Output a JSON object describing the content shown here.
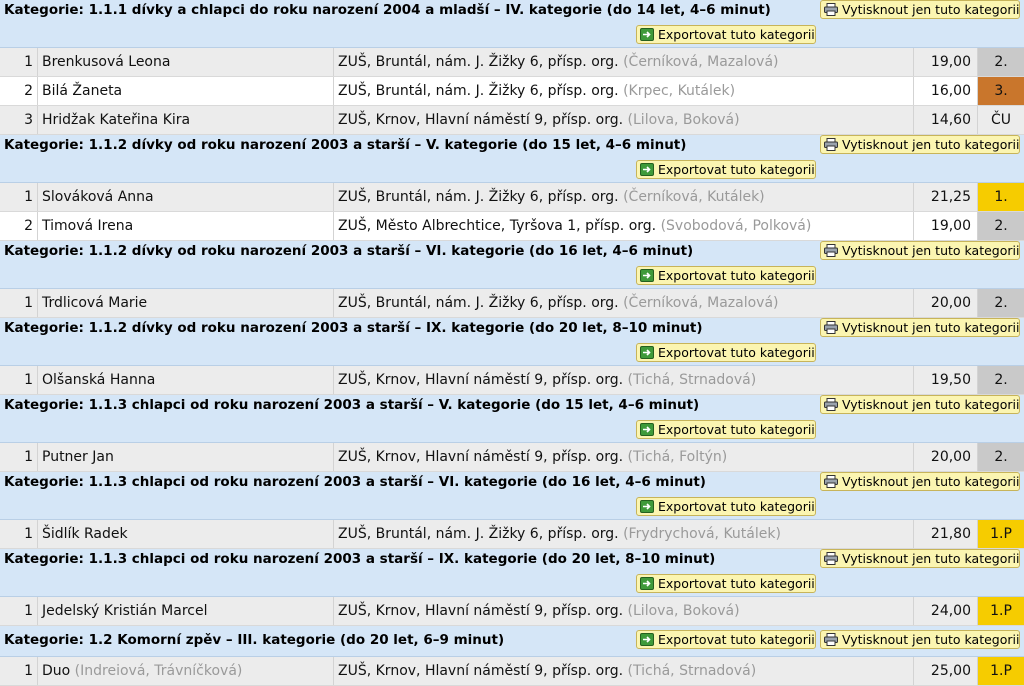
{
  "buttons": {
    "print_label": "Vytisknout jen tuto kategorii",
    "export_label": "Exportovat tuto kategorii"
  },
  "colors": {
    "header_bg": "#d5e6f7",
    "button_bg": "#fbf5b1",
    "place_gold": "#f6cc00",
    "place_silver": "#c9c9c9",
    "place_bronze": "#c9762c"
  },
  "categories": [
    {
      "title": "Kategorie: 1.1.1 dívky a chlapci do roku narození 2004 a mladší – IV. kategorie (do 14 let, 4–6 minut)",
      "rows": [
        {
          "num": "1",
          "name": "Brenkusová Leona",
          "name_extra": "",
          "school": "ZUŠ, Bruntál, nám. J. Žižky 6, přísp. org.",
          "teachers": "(Černíková, Mazalová)",
          "score": "19,00",
          "place": "2.",
          "medal": "silver"
        },
        {
          "num": "2",
          "name": "Bilá Žaneta",
          "name_extra": "",
          "school": "ZUŠ, Bruntál, nám. J. Žižky 6, přísp. org.",
          "teachers": "(Krpec, Kutálek)",
          "score": "16,00",
          "place": "3.",
          "medal": "bronze"
        },
        {
          "num": "3",
          "name": "Hridžak Kateřina Kira",
          "name_extra": "",
          "school": "ZUŠ, Krnov, Hlavní náměstí 9, přísp. org.",
          "teachers": "(Lilova, Boková)",
          "score": "14,60",
          "place": "ČU",
          "medal": "none"
        }
      ]
    },
    {
      "title": "Kategorie: 1.1.2 dívky od roku narození 2003 a starší – V. kategorie (do 15 let, 4–6 minut)",
      "rows": [
        {
          "num": "1",
          "name": "Slováková Anna",
          "name_extra": "",
          "school": "ZUŠ, Bruntál, nám. J. Žižky 6, přísp. org.",
          "teachers": "(Černíková, Kutálek)",
          "score": "21,25",
          "place": "1.",
          "medal": "gold"
        },
        {
          "num": "2",
          "name": "Timová Irena",
          "name_extra": "",
          "school": "ZUŠ, Město Albrechtice, Tyršova 1, přísp. org.",
          "teachers": "(Svobodová, Polková)",
          "score": "19,00",
          "place": "2.",
          "medal": "silver"
        }
      ]
    },
    {
      "title": "Kategorie: 1.1.2 dívky od roku narození 2003 a starší – VI. kategorie (do 16 let, 4–6 minut)",
      "rows": [
        {
          "num": "1",
          "name": "Trdlicová Marie",
          "name_extra": "",
          "school": "ZUŠ, Bruntál, nám. J. Žižky 6, přísp. org.",
          "teachers": "(Černíková, Mazalová)",
          "score": "20,00",
          "place": "2.",
          "medal": "silver"
        }
      ]
    },
    {
      "title": "Kategorie: 1.1.2 dívky od roku narození 2003 a starší – IX. kategorie (do 20 let, 8–10 minut)",
      "rows": [
        {
          "num": "1",
          "name": "Olšanská Hanna",
          "name_extra": "",
          "school": "ZUŠ, Krnov, Hlavní náměstí 9, přísp. org.",
          "teachers": "(Tichá, Strnadová)",
          "score": "19,50",
          "place": "2.",
          "medal": "silver"
        }
      ]
    },
    {
      "title": "Kategorie: 1.1.3 chlapci od roku narození 2003 a starší – V. kategorie (do 15 let, 4–6 minut)",
      "rows": [
        {
          "num": "1",
          "name": "Putner Jan",
          "name_extra": "",
          "school": "ZUŠ, Krnov, Hlavní náměstí 9, přísp. org.",
          "teachers": "(Tichá, Foltýn)",
          "score": "20,00",
          "place": "2.",
          "medal": "silver"
        }
      ]
    },
    {
      "title": "Kategorie: 1.1.3 chlapci od roku narození 2003 a starší – VI. kategorie (do 16 let, 4–6 minut)",
      "rows": [
        {
          "num": "1",
          "name": "Šidlík Radek",
          "name_extra": "",
          "school": "ZUŠ, Bruntál, nám. J. Žižky 6, přísp. org.",
          "teachers": "(Frydrychová, Kutálek)",
          "score": "21,80",
          "place": "1.P",
          "medal": "gold"
        }
      ]
    },
    {
      "title": "Kategorie: 1.1.3 chlapci od roku narození 2003 a starší – IX. kategorie (do 20 let, 8–10 minut)",
      "rows": [
        {
          "num": "1",
          "name": "Jedelský Kristián Marcel",
          "name_extra": "",
          "school": "ZUŠ, Krnov, Hlavní náměstí 9, přísp. org.",
          "teachers": "(Lilova, Boková)",
          "score": "24,00",
          "place": "1.P",
          "medal": "gold"
        }
      ]
    },
    {
      "title": "Kategorie: 1.2 Komorní zpěv – III. kategorie (do 20 let, 6–9 minut)",
      "single": true,
      "rows": [
        {
          "num": "1",
          "name": "Duo",
          "name_extra": "(Indreiová, Trávníčková)",
          "school": "ZUŠ, Krnov, Hlavní náměstí 9, přísp. org.",
          "teachers": "(Tichá, Strnadová)",
          "score": "25,00",
          "place": "1.P",
          "medal": "gold"
        }
      ]
    }
  ]
}
